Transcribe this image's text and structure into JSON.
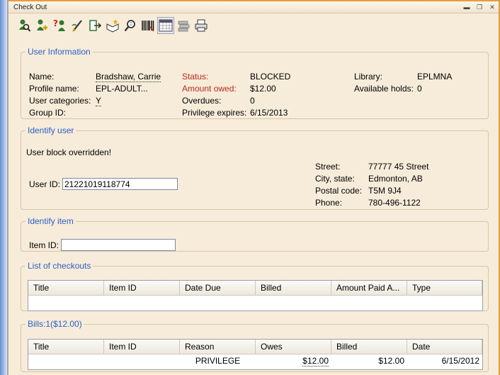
{
  "window": {
    "title": "Check Out",
    "minimize": "▬",
    "restore": "❐",
    "close": "✕"
  },
  "toolbar": {
    "icons": [
      "user-search-icon",
      "user-add-icon",
      "user-help-icon",
      "pen-edit-icon",
      "checkout-icon",
      "book-new-icon",
      "book-search-icon",
      "barcode-icon",
      "calendar-icon",
      "stack-icon",
      "printer-icon"
    ]
  },
  "user_info": {
    "legend": "User Information",
    "name_label": "Name:",
    "name_value": "Bradshaw, Carrie",
    "profile_label": "Profile name:",
    "profile_value": "EPL-ADULT...",
    "categories_label": "User categories:",
    "categories_value": "Y",
    "group_label": "Group ID:",
    "status_label": "Status:",
    "status_value": "BLOCKED",
    "owed_label": "Amount owed:",
    "owed_value": "$12.00",
    "overdues_label": "Overdues:",
    "overdues_value": "0",
    "privilege_label": "Privilege expires:",
    "privilege_value": "6/15/2013",
    "library_label": "Library:",
    "library_value": "EPLMNA",
    "holds_label": "Available holds:",
    "holds_value": "0"
  },
  "identify_user": {
    "legend": "Identify user",
    "message": "User block overridden!",
    "user_id_label": "User ID:",
    "user_id_value": "21221019118774",
    "street_label": "Street:",
    "street_value": "77777 45 Street",
    "city_label": "City, state:",
    "city_value": "Edmonton, AB",
    "postal_label": "Postal code:",
    "postal_value": "T5M 9J4",
    "phone_label": "Phone:",
    "phone_value": "780-496-1122"
  },
  "identify_item": {
    "legend": "Identify item",
    "item_id_label": "Item ID:",
    "item_id_value": ""
  },
  "checkouts": {
    "legend": "List of checkouts",
    "columns": [
      "Title",
      "Item ID",
      "Date Due",
      "Billed",
      "Amount Paid A...",
      "Type"
    ]
  },
  "bills": {
    "legend": "Bills:1($12.00)",
    "columns": [
      "Title",
      "Item ID",
      "Reason",
      "Owes",
      "Billed",
      "Date"
    ],
    "rows": [
      {
        "title": "",
        "item_id": "",
        "reason": "PRIVILEGE",
        "owes": "$12.00",
        "billed": "$12.00",
        "date": "6/15/2012"
      }
    ]
  }
}
